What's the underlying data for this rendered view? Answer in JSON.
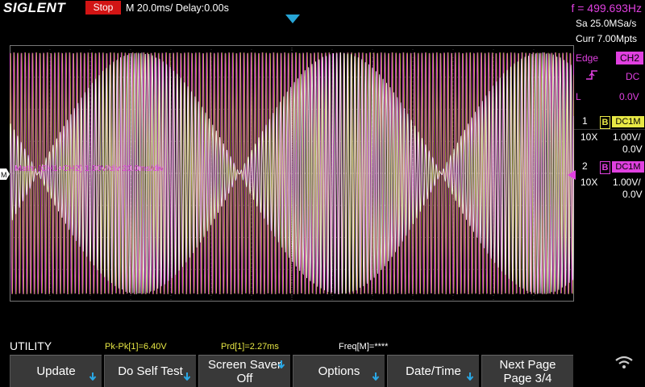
{
  "header": {
    "logo": "SIGLENT",
    "run_state": "Stop",
    "timebase": "M 20.0ms/ Delay:0.00s",
    "frequency": "f = 499.693Hz"
  },
  "acquisition": {
    "sample_rate": "Sa 25.0MSa/s",
    "memory_depth": "Curr 7.00Mpts"
  },
  "trigger": {
    "type": "Edge",
    "source": "CH2",
    "slope_icon": "rising-edge-icon",
    "coupling": "DC",
    "mode": "L",
    "level": "0.0V"
  },
  "channels": [
    {
      "number": "1",
      "bw_limit": "B",
      "coupling": "DC1M",
      "probe": "10X",
      "scale": "1.00V/",
      "offset": "0.0V",
      "color": "#e8e845"
    },
    {
      "number": "2",
      "bw_limit": "B",
      "coupling": "DC1M",
      "probe": "10X",
      "scale": "1.00V/",
      "offset": "0.0V",
      "color": "#e040e0"
    }
  ],
  "math_label": "Math: (CH1+CH2) 1.00V/div 20.0ms/div",
  "menu_title": "UTILITY",
  "measurements": [
    {
      "label": "Pk-Pk[1]=6.40V",
      "color": "#e8e845"
    },
    {
      "label": "Prd[1]=2.27ms",
      "color": "#e8e845"
    },
    {
      "label": "Freq[M]=****",
      "color": "#ffffff"
    }
  ],
  "softkeys": [
    {
      "label": "Update"
    },
    {
      "label": "Do Self Test"
    },
    {
      "label": "Screen Saver",
      "sub": "Off"
    },
    {
      "label": "Options"
    },
    {
      "label": "Date/Time"
    },
    {
      "label": "Next Page",
      "sub": "Page 3/4"
    }
  ],
  "status_icon": "wifi-icon",
  "colors": {
    "ch1": "#e8e845",
    "ch2": "#e040e0",
    "math": "#ffffff",
    "trigger_marker": "#27a5d6",
    "stop": "#d21414"
  }
}
